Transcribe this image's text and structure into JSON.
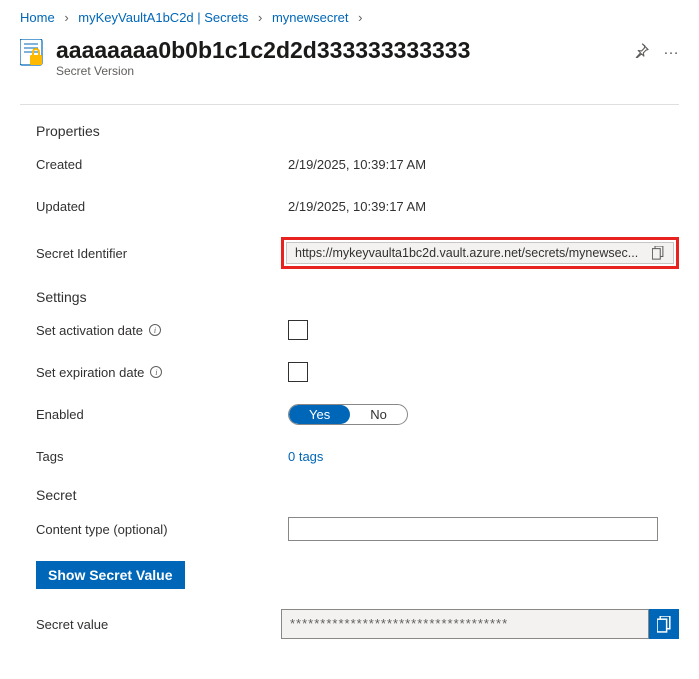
{
  "breadcrumb": {
    "home": "Home",
    "vault": "myKeyVaultA1bC2d | Secrets",
    "secret": "mynewsecret"
  },
  "header": {
    "title": "aaaaaaaa0b0b1c1c2d2d333333333333",
    "subtitle": "Secret Version"
  },
  "sections": {
    "properties": "Properties",
    "settings": "Settings",
    "secret": "Secret"
  },
  "props": {
    "created_label": "Created",
    "created_value": "2/19/2025, 10:39:17 AM",
    "updated_label": "Updated",
    "updated_value": "2/19/2025, 10:39:17 AM",
    "identifier_label": "Secret Identifier",
    "identifier_value": "https://mykeyvaulta1bc2d.vault.azure.net/secrets/mynewsec..."
  },
  "settings": {
    "activation_label": "Set activation date",
    "expiration_label": "Set expiration date",
    "enabled_label": "Enabled",
    "enabled_yes": "Yes",
    "enabled_no": "No",
    "tags_label": "Tags",
    "tags_value": "0 tags"
  },
  "secret": {
    "content_type_label": "Content type (optional)",
    "content_type_value": "",
    "show_button": "Show Secret Value",
    "value_label": "Secret value",
    "masked_value": "************************************"
  }
}
